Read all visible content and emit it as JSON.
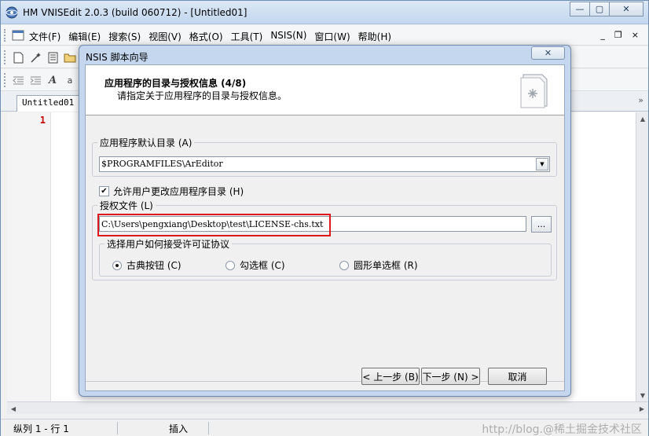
{
  "window": {
    "title": "HM VNISEdit 2.0.3 (build 060712) - [Untitled01]",
    "controls": {
      "minimize": "—",
      "restore": "▢",
      "close": "✕"
    }
  },
  "menubar": {
    "items": [
      "文件(F)",
      "编辑(E)",
      "搜索(S)",
      "视图(V)",
      "格式(O)",
      "工具(T)",
      "NSIS(N)",
      "窗口(W)",
      "帮助(H)"
    ],
    "mdi": {
      "minimize": "_",
      "restore": "❐",
      "close": "×"
    }
  },
  "toolbar1": {
    "icons": [
      "new-file-icon",
      "open-wizard-icon",
      "open-template-icon",
      "open-folder-icon"
    ]
  },
  "toolbar2": {
    "icons": [
      "outdent-icon",
      "indent-icon",
      "font-icon",
      "font-size-icon"
    ]
  },
  "tabs": {
    "active": "Untitled01",
    "scroll_label": "»"
  },
  "editor": {
    "line_number": "1"
  },
  "statusbar": {
    "position": "纵列 1 - 行 1",
    "mode": "插入",
    "watermark": "http://blog.@稀土掘金技术社区"
  },
  "dialog": {
    "title": "NSIS 脚本向导",
    "close_label": "✕",
    "header": {
      "title": "应用程序的目录与授权信息 (4/8)",
      "subtitle": "请指定关于应用程序的目录与授权信息。"
    },
    "install_dir": {
      "group_label": "应用程序默认目录 (A)",
      "value": "$PROGRAMFILES\\ArEditor"
    },
    "allow_change": {
      "label": "允许用户更改应用程序目录 (H)",
      "checked": true
    },
    "license": {
      "group_label": "授权文件 (L)",
      "value": "C:\\Users\\pengxiang\\Desktop\\test\\LICENSE-chs.txt",
      "browse_label": "...",
      "highlight_color": "#e0181e",
      "accept": {
        "group_label": "选择用户如何接受许可证协议",
        "options": [
          {
            "label": "古典按钮 (C)",
            "selected": true
          },
          {
            "label": "勾选框 (C)",
            "selected": false
          },
          {
            "label": "圆形单选框 (R)",
            "selected": false
          }
        ]
      }
    },
    "buttons": {
      "back": "< 上一步 (B)",
      "next": "下一步 (N) >",
      "cancel": "取消"
    }
  }
}
